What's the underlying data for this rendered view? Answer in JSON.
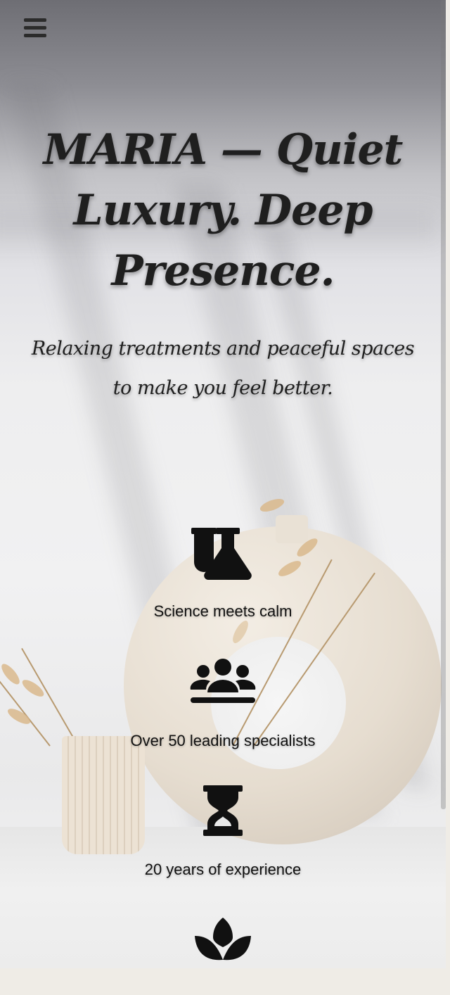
{
  "nav": {
    "menu_icon": "hamburger-menu-icon"
  },
  "hero": {
    "title": "MARIA — Quiet Luxury. Deep Presence.",
    "subtitle": "Relaxing treatments and peaceful spaces to make you feel better."
  },
  "features": [
    {
      "icon": "flask-icon",
      "label": "Science meets calm"
    },
    {
      "icon": "users-icon",
      "label": "Over 50 leading specialists"
    },
    {
      "icon": "hourglass-icon",
      "label": "20 years of experience"
    },
    {
      "icon": "lotus-icon",
      "label": ""
    }
  ],
  "colors": {
    "text": "#1f1f1f",
    "background": "#efece6"
  }
}
